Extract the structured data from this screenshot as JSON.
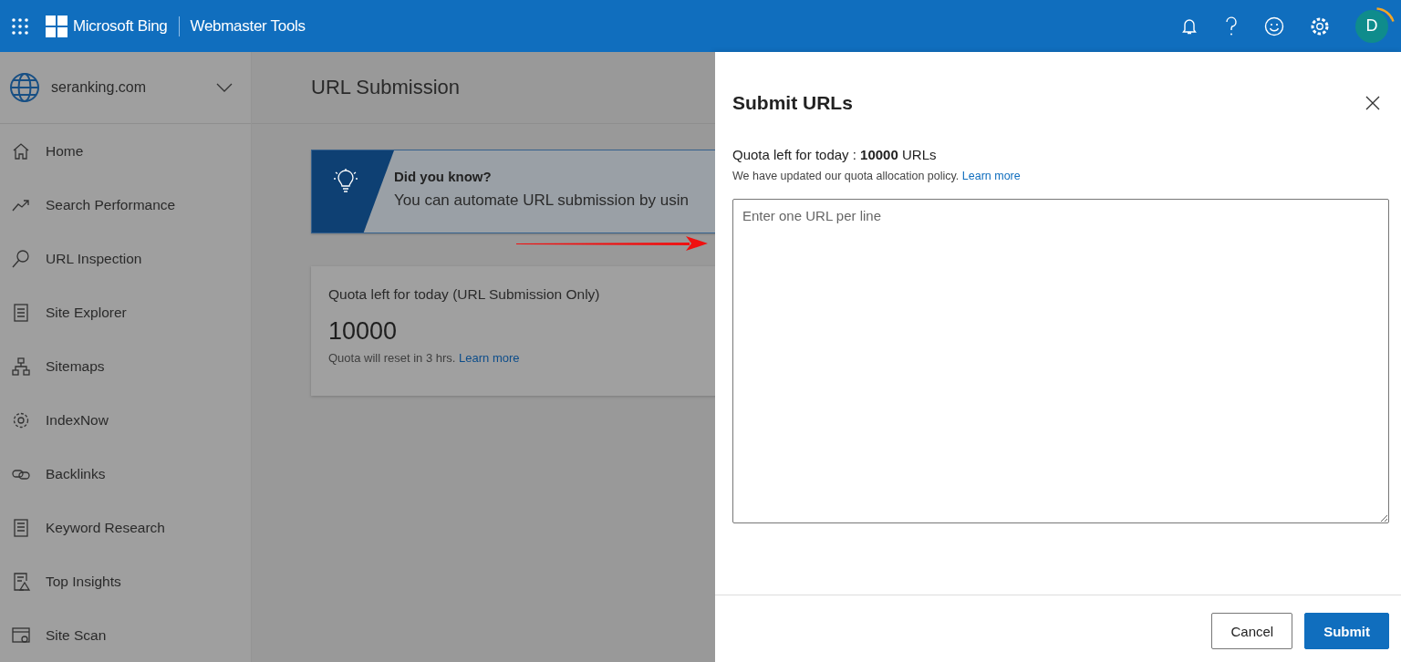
{
  "topbar": {
    "brand": "Microsoft Bing",
    "product": "Webmaster Tools",
    "avatar": "D"
  },
  "site_picker": {
    "site": "seranking.com"
  },
  "sidebar": {
    "items": [
      {
        "label": "Home"
      },
      {
        "label": "Search Performance"
      },
      {
        "label": "URL Inspection"
      },
      {
        "label": "Site Explorer"
      },
      {
        "label": "Sitemaps"
      },
      {
        "label": "IndexNow"
      },
      {
        "label": "Backlinks"
      },
      {
        "label": "Keyword Research"
      },
      {
        "label": "Top Insights"
      },
      {
        "label": "Site Scan"
      }
    ]
  },
  "page": {
    "title": "URL Submission",
    "tip": {
      "heading": "Did you know?",
      "text": "You can automate URL submission by usin"
    },
    "quota_card": {
      "title": "Quota left for today (URL Submission Only)",
      "value": "10000",
      "note": "Quota will reset in 3 hrs.",
      "link": "Learn more"
    }
  },
  "dialog": {
    "title": "Submit URLs",
    "quota": "Quota left for today : **10000** URLs",
    "policy": "We have updated our quota allocation policy.",
    "policy_link": "Learn more",
    "placeholder": "Enter one URL per line",
    "buttons": [
      {
        "label": "Cancel",
        "kind": "secondary"
      },
      {
        "label": "Submit",
        "kind": "primary"
      }
    ]
  }
}
